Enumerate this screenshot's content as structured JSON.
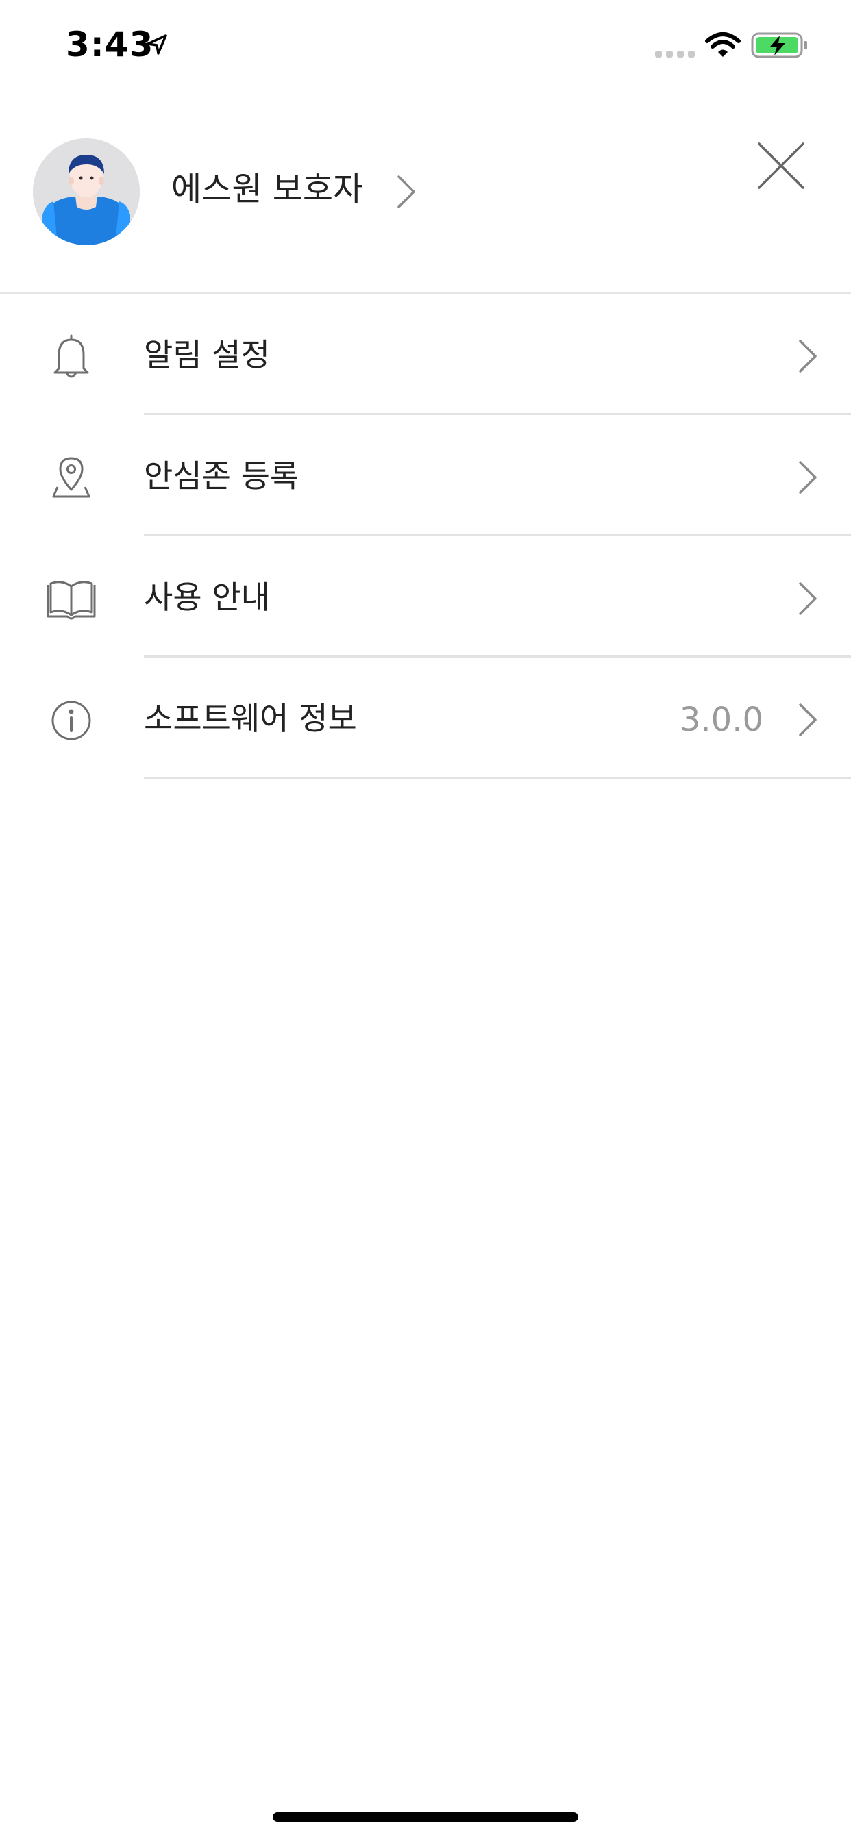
{
  "status_bar": {
    "time": "3:43",
    "icons": [
      "location-arrow-icon",
      "cellular-signal-icon",
      "wifi-icon",
      "battery-charging-icon"
    ],
    "battery_color": "#4cd964"
  },
  "profile": {
    "name": "에스원 보호자",
    "avatar_icon": "user-avatar-icon"
  },
  "menu": {
    "items": [
      {
        "label": "알림 설정",
        "icon": "bell-icon",
        "value": ""
      },
      {
        "label": "안심존 등록",
        "icon": "location-pin-icon",
        "value": ""
      },
      {
        "label": "사용 안내",
        "icon": "book-icon",
        "value": ""
      },
      {
        "label": "소프트웨어 정보",
        "icon": "info-icon",
        "value": "3.0.0"
      }
    ]
  },
  "colors": {
    "text": "#222222",
    "secondary_text": "#9a9a9a",
    "divider": "#e2e2e2",
    "icon_stroke": "#6e6e6e"
  }
}
